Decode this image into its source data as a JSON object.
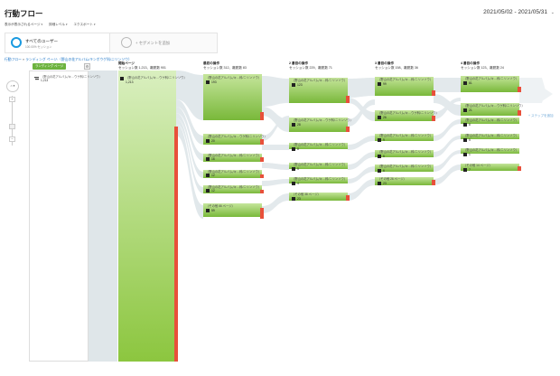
{
  "header": {
    "title": "行動フロー",
    "date_range": "2021/05/02 - 2021/05/31",
    "date_chevron": "⌄"
  },
  "toolbar": {
    "items": [
      "表示が表示されるページ",
      "詳細レベル",
      "エクスポート"
    ],
    "caret": "▾"
  },
  "segments": {
    "active_name": "すべてのユーザー",
    "active_sub": "100.00% セッション",
    "add_label": "+ セグメントを追加"
  },
  "breadcrumb": {
    "root": "行動フロー",
    "separator": "»",
    "current": "ランディング ページ:（野山の花アルバム/キンポウゲ科/ニリンソウ）"
  },
  "zoom": {
    "home": "⌂ ▾",
    "plus": "+",
    "minus": "−"
  },
  "dimension": {
    "pill": "ランディング ページ",
    "gear": "⚙",
    "row_label": "（野山の花アルバム/キ…ウゲ科/ニリンソウ）",
    "row_value": "1,213"
  },
  "columns": [
    {
      "title": "開始ページ",
      "stats": "セッション数 1,213、離脱数 901"
    },
    {
      "title": "最初の操作",
      "stats": "セッション数 312、離脱数 83"
    },
    {
      "title": "2 番目の操作",
      "stats": "セッション数 229、離脱数 71"
    },
    {
      "title": "3 番目の操作",
      "stats": "セッション数 158、離脱数 36"
    },
    {
      "title": "4 番目の操作",
      "stats": "セッション数 123、離脱数 24"
    }
  ],
  "nodes": [
    {
      "col": 0,
      "label": "（野山の花アルバム/キ…ウゲ科/ニリンソウ）",
      "value": "1,213"
    },
    {
      "col": 1,
      "label": "（野山の花アルバム/キ…科/ニリンソウ）",
      "value": "193"
    },
    {
      "col": 1,
      "label": "（野山の花アルバム/キ…ウゲ科/ニリンソウ）",
      "value": "20"
    },
    {
      "col": 1,
      "label": "（野山の花アルバム/キ…科/ニリンソウ）",
      "value": "16"
    },
    {
      "col": 1,
      "label": "（野山の花アルバム/キ…科/ニリンソウ）",
      "value": "12"
    },
    {
      "col": 1,
      "label": "（野山の花アルバム/キ…科/ニリンソウ）",
      "value": "12"
    },
    {
      "col": 1,
      "label": "（その他 66 ページ）",
      "value": "59"
    },
    {
      "col": 2,
      "label": "（野山の花アルバム/キ…科/ニリンソウ）",
      "value": "123"
    },
    {
      "col": 2,
      "label": "（野山の花アルバム/キ…ウゲ科/ニリンソウ）",
      "value": "28"
    },
    {
      "col": 2,
      "label": "（野山の花アルバム/キ…科/ニリンソウ）",
      "value": "8"
    },
    {
      "col": 2,
      "label": "（野山の花アルバム/キ…科/ニリンソウ）",
      "value": "5"
    },
    {
      "col": 2,
      "label": "（野山の花アルバム/キ…科/ニリンソウ）",
      "value": "4"
    },
    {
      "col": 2,
      "label": "（その他 38 ページ）",
      "value": "23"
    },
    {
      "col": 3,
      "label": "（野山の花アルバム/キ…科/ニリンソウ）",
      "value": "99"
    },
    {
      "col": 3,
      "label": "（野山の花アルバム/キ…ウゲ科/ニリンソウ）",
      "value": "26"
    },
    {
      "col": 3,
      "label": "（野山の花アルバム/キ…科/ニリンソウ）",
      "value": "9"
    },
    {
      "col": 3,
      "label": "（野山の花アルバム/キ…科/ニリンソウ）",
      "value": "6"
    },
    {
      "col": 3,
      "label": "（野山の花アルバム/キ…科/ニリンソウ）",
      "value": "6"
    },
    {
      "col": 3,
      "label": "（その他 26 ページ）",
      "value": "23"
    },
    {
      "col": 4,
      "label": "（野山の花アルバム/キ…科/ニリンソウ）",
      "value": "81"
    },
    {
      "col": 4,
      "label": "（野山の花アルバム/キ…ウゲ科/ニリンソウ）",
      "value": "21"
    },
    {
      "col": 4,
      "label": "（野山の花アルバム/キ…科/ニリンソウ）",
      "value": "8"
    },
    {
      "col": 4,
      "label": "（野山の花アルバム/キ…科/ニリンソウ）",
      "value": "5"
    },
    {
      "col": 4,
      "label": "（野山の花アルバム/キ…科/ニリンソウ）",
      "value": "1"
    },
    {
      "col": 4,
      "label": "（その他 14 ページ）",
      "value": "7"
    }
  ],
  "next_step": "+ ステップを追加",
  "colors": {
    "node_green": "#8cc63f",
    "node_green_light": "#cde9a8",
    "dropoff_red": "#e8503a",
    "flow_gray": "#cfd8dc",
    "accent_blue": "#1a9ae0"
  }
}
